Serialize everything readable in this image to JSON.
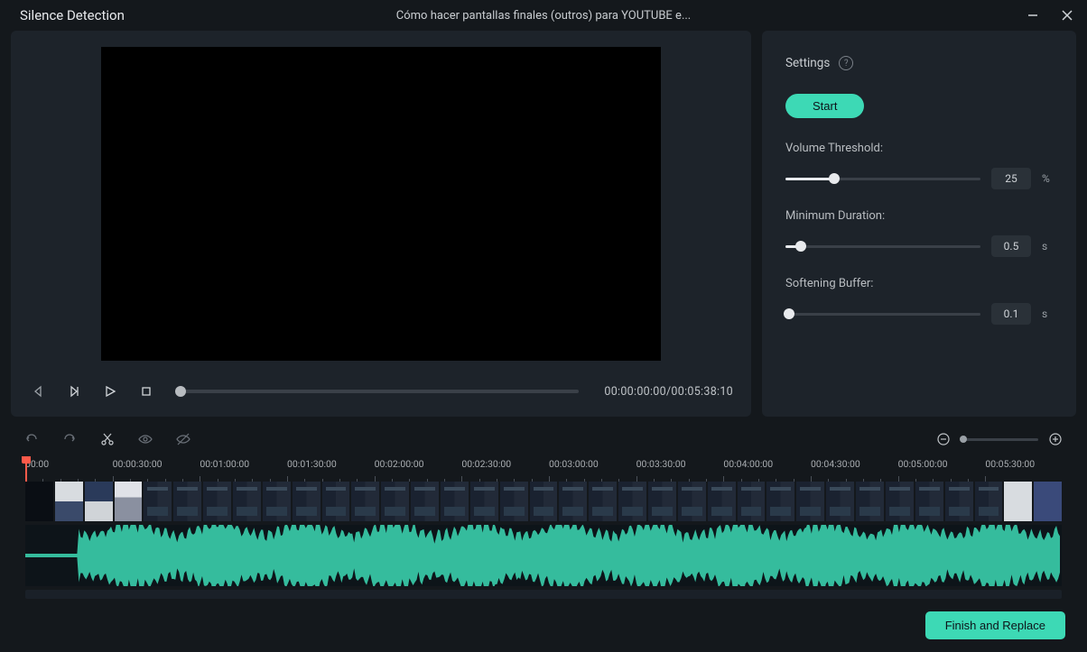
{
  "window": {
    "title": "Silence Detection",
    "subtitle": "Cómo hacer pantallas finales (outros) para YOUTUBE e..."
  },
  "preview": {
    "timecode": "00:00:00:00/00:05:38:10"
  },
  "settings": {
    "header": "Settings",
    "start": "Start",
    "volume_threshold": {
      "label": "Volume Threshold:",
      "value": "25",
      "unit": "%",
      "pct": 25
    },
    "minimum_duration": {
      "label": "Minimum Duration:",
      "value": "0.5",
      "unit": "s",
      "pct": 8
    },
    "softening_buffer": {
      "label": "Softening Buffer:",
      "value": "0.1",
      "unit": "s",
      "pct": 2
    }
  },
  "ruler": {
    "labels": [
      "00:00",
      "00:00:30:00",
      "00:01:00:00",
      "00:01:30:00",
      "00:02:00:00",
      "00:02:30:00",
      "00:03:00:00",
      "00:03:30:00",
      "00:04:00:00",
      "00:04:30:00",
      "00:05:00:00",
      "00:05:30:00"
    ]
  },
  "footer": {
    "finish": "Finish and Replace"
  }
}
